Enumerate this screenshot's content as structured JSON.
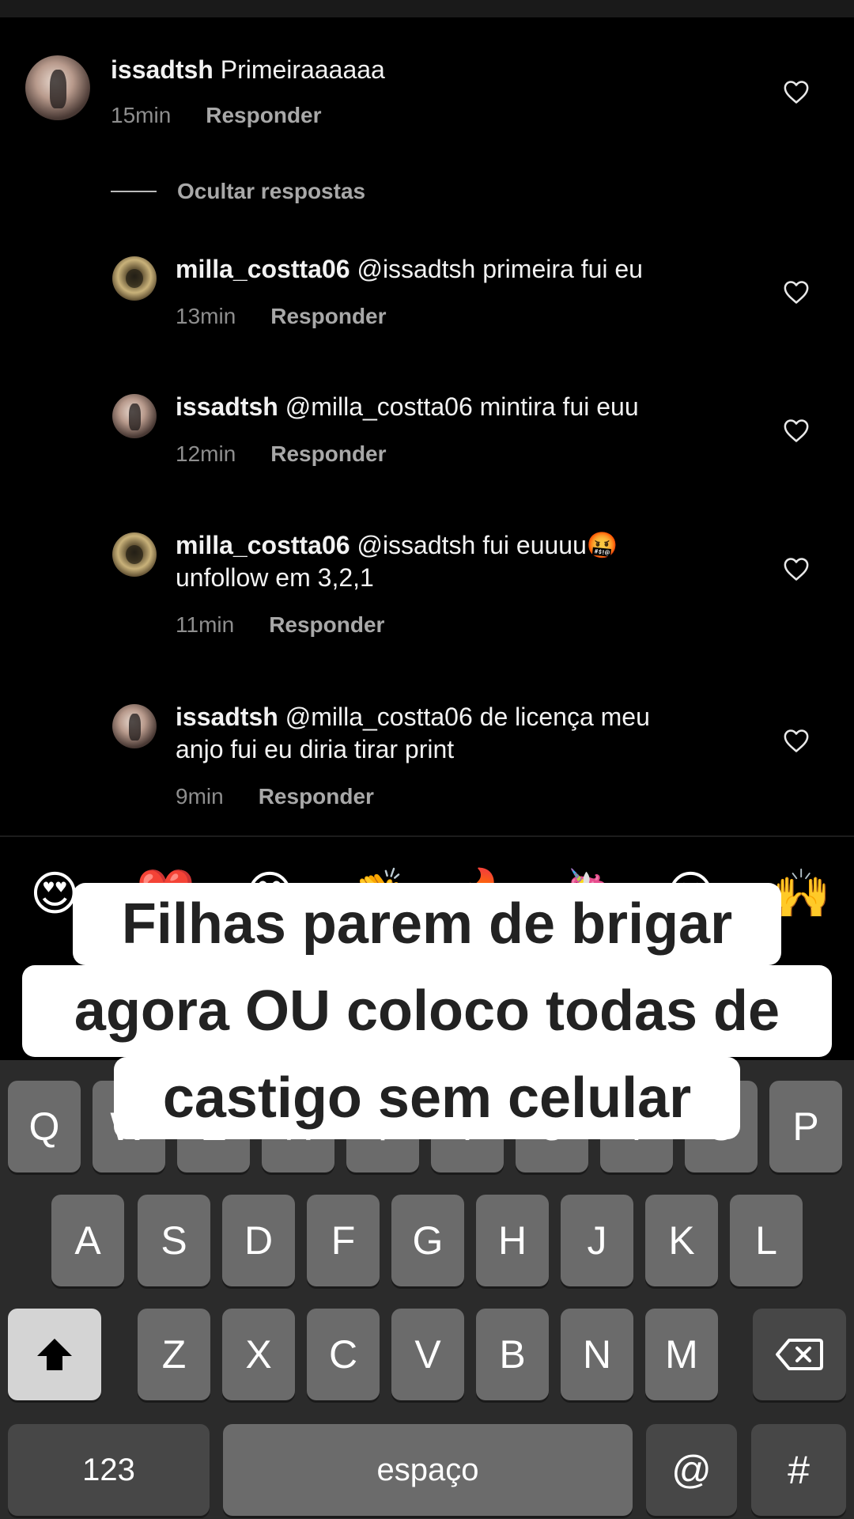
{
  "comments": [
    {
      "user": "issadtsh",
      "text": "Primeiraaaaaa",
      "time": "15min",
      "reply_label": "Responder"
    },
    {
      "user": "milla_costta06",
      "text": "@issadtsh primeira fui eu",
      "time": "13min",
      "reply_label": "Responder"
    },
    {
      "user": "issadtsh",
      "text": "@milla_costta06 mintira fui euu",
      "time": "12min",
      "reply_label": "Responder"
    },
    {
      "user": "milla_costta06",
      "text": "@issadtsh fui euuuu🤬",
      "text2": "unfollow em 3,2,1",
      "time": "11min",
      "reply_label": "Responder"
    },
    {
      "user": "issadtsh",
      "text": "@milla_costta06  de licença meu",
      "text2": "anjo fui eu diria tirar print",
      "time": "9min",
      "reply_label": "Responder"
    }
  ],
  "hide_replies_label": "Ocultar respostas",
  "emojis": [
    "😍",
    "❤️",
    "😂",
    "👏",
    "🔥",
    "🦄",
    "😮",
    "🙌"
  ],
  "caption": {
    "line1": "Filhas parem de brigar",
    "line2": "agora OU coloco todas de",
    "line3": "castigo sem celular"
  },
  "keyboard": {
    "row1": [
      "Q",
      "W",
      "E",
      "R",
      "T",
      "Y",
      "U",
      "I",
      "O",
      "P"
    ],
    "row2": [
      "A",
      "S",
      "D",
      "F",
      "G",
      "H",
      "J",
      "K",
      "L"
    ],
    "row3": [
      "Z",
      "X",
      "C",
      "V",
      "B",
      "N",
      "M"
    ],
    "numbers_label": "123",
    "space_label": "espaço",
    "at_label": "@",
    "hash_label": "#"
  },
  "icons": {
    "heart": "heart-outline-icon",
    "shift": "shift-arrow-icon",
    "backspace": "backspace-icon"
  },
  "colors": {
    "background": "#000000",
    "muted_text": "#8e8e8e",
    "keyboard_bg": "#2b2b2b",
    "key": "#6b6b6b",
    "caption_bg": "#ffffff"
  }
}
